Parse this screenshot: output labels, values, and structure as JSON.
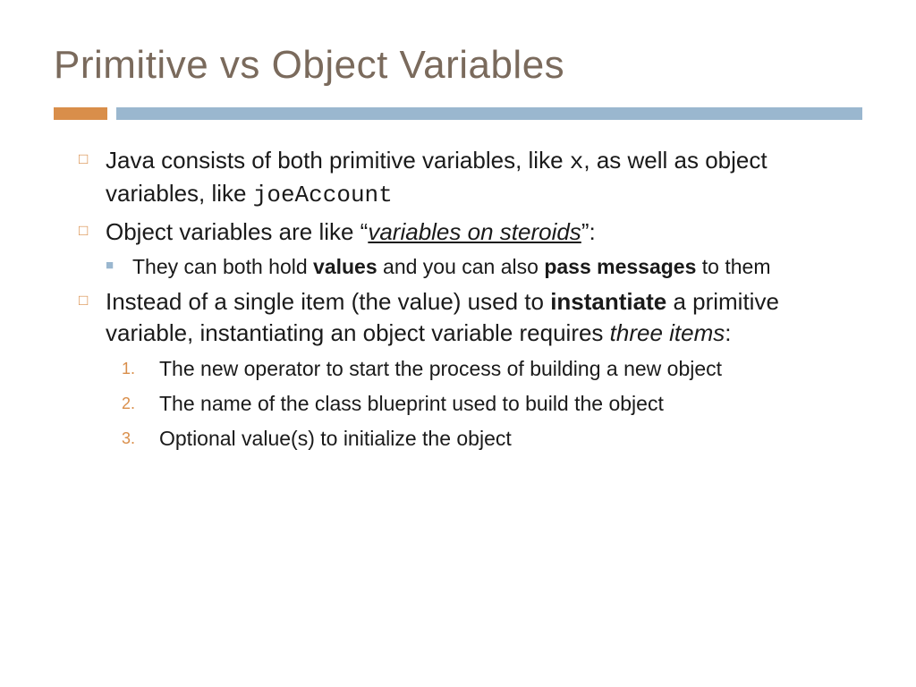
{
  "title": "Primitive vs Object Variables",
  "bullets": {
    "b1": {
      "pre": "Java consists of both primitive variables, like ",
      "code1": "x",
      "mid": ", as well as object variables, like ",
      "code2": "joeAccount"
    },
    "b2": {
      "pre": "Object variables are like “",
      "u": "variables on steroids",
      "post": "”:"
    },
    "b2a": {
      "pre": "They can both hold ",
      "bold1": "values",
      "mid": " and you can also ",
      "bold2": "pass messages",
      "post": " to them"
    },
    "b3": {
      "pre": "Instead of a single item (the value) used to ",
      "bold1": "instantiate",
      "mid": " a primitive variable, instantiating an object variable requires ",
      "ital": "three items",
      "post": ":"
    },
    "n1": "The new operator to start the process of building a new object",
    "n2": "The name of the class blueprint used to build the object",
    "n3": "Optional value(s) to initialize the object"
  },
  "markers": {
    "sq_open": "□",
    "sq_filled": "■",
    "num1": "1.",
    "num2": "2.",
    "num3": "3."
  }
}
